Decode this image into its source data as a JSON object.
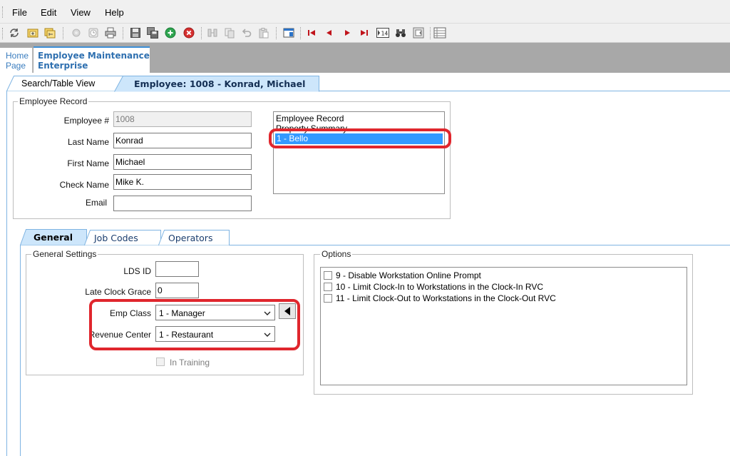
{
  "menu": {
    "file": "File",
    "edit": "Edit",
    "view": "View",
    "help": "Help"
  },
  "app_tabs": {
    "home_line1": "Home",
    "home_line2": "Page",
    "employee_line1": "Employee Maintenance",
    "employee_line2": "Enterprise"
  },
  "view_tabs": {
    "search": "Search/Table View",
    "employee": "Employee: 1008 - Konrad, Michael"
  },
  "employee_record": {
    "legend": "Employee Record",
    "employee_no_label": "Employee #",
    "employee_no": "1008",
    "last_name_label": "Last Name",
    "last_name": "Konrad",
    "first_name_label": "First Name",
    "first_name": "Michael",
    "check_name_label": "Check Name",
    "check_name": "Mike K.",
    "email_label": "Email",
    "email": ""
  },
  "property_list": {
    "header1": "Employee Record",
    "header2": "Property Summary",
    "selected_item": "1 - Bello"
  },
  "sub_tabs": {
    "general": "General",
    "job_codes": "Job Codes",
    "operators": "Operators"
  },
  "general_settings": {
    "legend": "General Settings",
    "lds_id_label": "LDS ID",
    "lds_id": "",
    "late_clock_grace_label": "Late Clock Grace",
    "late_clock_grace": "0",
    "emp_class_label": "Emp Class",
    "emp_class": "1 - Manager",
    "revenue_center_label": "Revenue Center",
    "revenue_center": "1 - Restaurant",
    "in_training_label": "In Training"
  },
  "options": {
    "legend": "Options",
    "items": [
      "9 - Disable Workstation Online Prompt",
      "10 - Limit Clock-In to Workstations in the Clock-In RVC",
      "11 - Limit Clock-Out to Workstations in the Clock-Out RVC"
    ]
  },
  "colors": {
    "highlight": "#e0262d",
    "selection": "#3399ff",
    "active_tab": "#cde6fb",
    "tab_border": "#7fb4e2"
  },
  "toolbar_icons": [
    "refresh-icon",
    "open-folder-icon",
    "folder-tree-icon",
    "circle-disabled-icon",
    "clock-icon",
    "print-icon",
    "save-icon",
    "save-all-icon",
    "add-record-icon",
    "delete-record-icon",
    "column-icon",
    "copy-icon",
    "undo-icon",
    "paste-icon",
    "window-icon",
    "first-record-icon",
    "previous-record-icon",
    "next-record-icon",
    "last-record-icon",
    "goto-record-icon",
    "binoculars-icon",
    "form-view-icon",
    "table-view-icon"
  ]
}
